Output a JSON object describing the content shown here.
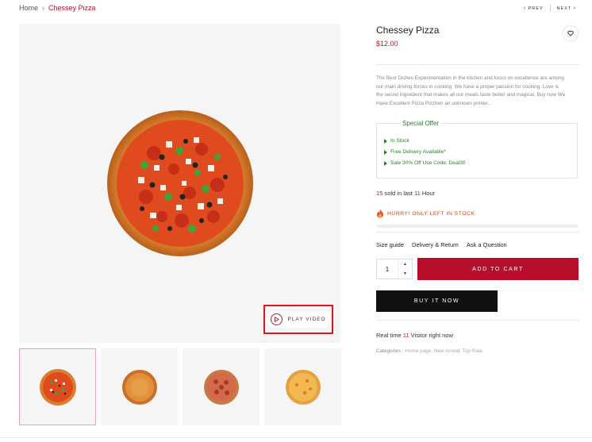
{
  "breadcrumb": {
    "home": "Home",
    "separator": "›",
    "current": "Chessey Pizza"
  },
  "nav": {
    "prev": "PREV",
    "next": "NEXT",
    "prev_arrow": "‹",
    "next_arrow": "›"
  },
  "media": {
    "play_video_label": "PLAY VIDEO"
  },
  "product": {
    "title": "Chessey Pizza",
    "price": "$12.00",
    "description": "The Best Dishes Experimentation in the kitchen and focus on excellence are among our main driving forces in cooking.  We have a proper passion for cooking. Love is the secret ingredient that makes all our meals taste better and magical. Buy now We Have Excellent Pizza Pizzhen an unknown printer...",
    "offer": {
      "title": "Special Offer",
      "items": [
        "In Stock",
        "Free Delivery Available*",
        "Sale 30% Off Use Code: Deal30"
      ]
    },
    "sold": {
      "count": "15",
      "text_mid": "sold in last",
      "hours": "11",
      "text_end": "Hour"
    },
    "hurry": "HURRY! ONLY LEFT IN STOCK",
    "links": {
      "size_guide": "Size guide",
      "delivery": "Delivery & Return",
      "ask": "Ask a Question"
    },
    "quantity": "1",
    "add_to_cart": "ADD TO CART",
    "buy_now": "BUY IT NOW",
    "visitors": {
      "prefix": "Real time",
      "count": "11",
      "suffix": "Visitor right now"
    },
    "categories": {
      "label": "Categories :",
      "items": "Home page, New Arrival, Top Rate"
    }
  },
  "colors": {
    "accent": "#b80e2b",
    "offer_green": "#2e7d32",
    "highlight_box": "#e0141e"
  },
  "icons": {
    "heart": "heart-icon",
    "play": "play-icon",
    "fire": "fire-icon"
  }
}
